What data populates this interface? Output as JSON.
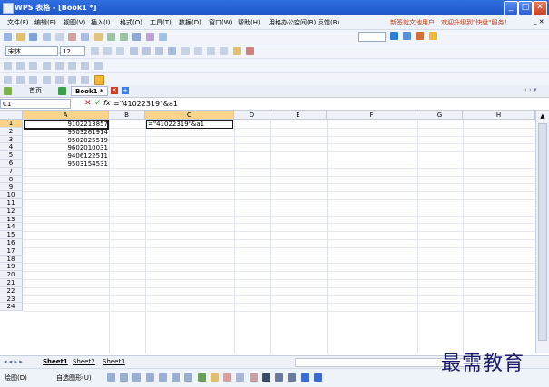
{
  "window": {
    "title": "WPS 表格 - [Book1 *]"
  },
  "menu": {
    "items": [
      "文件(F)",
      "编辑(E)",
      "视图(V)",
      "插入(I)",
      "格式(O)",
      "工具(T)",
      "数据(D)",
      "窗口(W)",
      "帮助(H)",
      "用格办公空间(B)",
      "反馈(B)"
    ],
    "notice": "新签就文他用户：欢迎升级到\"快盘\"服务！"
  },
  "format_toolbar": {
    "font": "宋体",
    "size": "12"
  },
  "tabs": {
    "home": "首页",
    "doc": "Book1 *"
  },
  "formula_bar": {
    "cell_ref": "C1",
    "formula": "=\"41022319\"&a1"
  },
  "grid": {
    "columns": [
      "A",
      "B",
      "C",
      "D",
      "E",
      "F",
      "G",
      "H"
    ],
    "rows": [
      "1",
      "2",
      "3",
      "4",
      "5",
      "6",
      "7",
      "8",
      "9",
      "10",
      "11",
      "12",
      "13",
      "14",
      "15",
      "16",
      "17",
      "18",
      "19",
      "20",
      "21",
      "22",
      "23",
      "24"
    ],
    "col_a_values": [
      "9102213857",
      "9503261914",
      "9502025519",
      "9602010031",
      "9406122511",
      "9503154531"
    ],
    "c1_value": "=\"41022319\"&a1"
  },
  "sheets": [
    "Sheet1",
    "Sheet2",
    "Sheet3"
  ],
  "drawbar": {
    "draw": "绘图(D)",
    "autoshape": "自选图形(U)"
  },
  "watermark": "最需教育",
  "colors": {
    "title": "#2f6fe0",
    "selection": "#f9d48a"
  }
}
